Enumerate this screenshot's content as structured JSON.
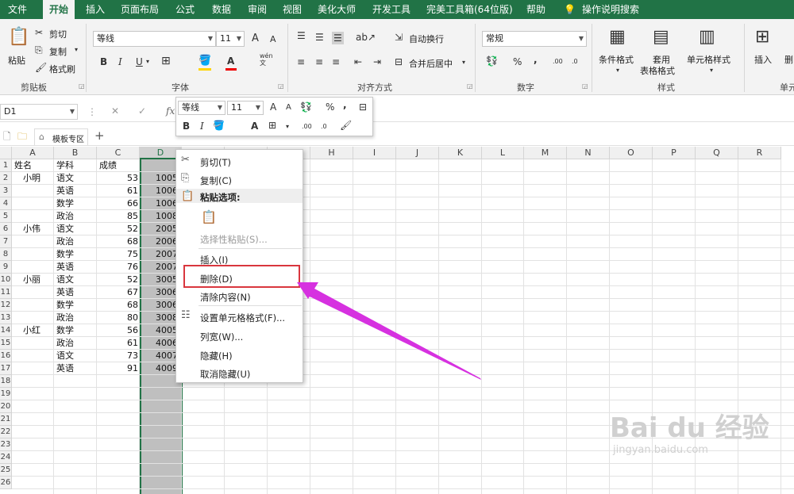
{
  "tabs": [
    "文件",
    "开始",
    "插入",
    "页面布局",
    "公式",
    "数据",
    "审阅",
    "视图",
    "美化大师",
    "开发工具",
    "完美工具箱(64位版)",
    "帮助",
    "操作说明搜索"
  ],
  "clipboard": {
    "paste": "粘贴",
    "cut": "剪切",
    "copy": "复制",
    "painter": "格式刷",
    "group": "剪贴板"
  },
  "font": {
    "name": "等线",
    "size": "11",
    "grow": "A",
    "shrink": "A",
    "bold": "B",
    "italic": "I",
    "underline": "U",
    "group": "字体",
    "wen": "wén",
    "wen2": "文"
  },
  "align": {
    "wrap": "自动换行",
    "merge": "合并后居中",
    "group": "对齐方式"
  },
  "number": {
    "format": "常规",
    "percent": "%",
    "comma": ",",
    "group": "数字",
    "dec_inc": ".00",
    "dec_dec": ".0"
  },
  "styles": {
    "cond": "条件格式",
    "table1": "套用",
    "table2": "表格格式",
    "cell": "单元格样式",
    "group": "样式"
  },
  "cells": {
    "insert": "插入",
    "delete": "删",
    "group": "单元"
  },
  "formula_bar": {
    "name_box": "D1",
    "fx": "fx"
  },
  "template_tab": "模板专区",
  "columns": [
    "A",
    "B",
    "C",
    "D",
    "E",
    "F",
    "G",
    "H",
    "I",
    "J",
    "K",
    "L",
    "M",
    "N",
    "O",
    "P",
    "Q",
    "R"
  ],
  "rows": [
    "1",
    "2",
    "3",
    "4",
    "5",
    "6",
    "7",
    "8",
    "9",
    "10",
    "11",
    "12",
    "13",
    "14",
    "15",
    "16",
    "17",
    "18",
    "19",
    "20",
    "21",
    "22",
    "23",
    "24",
    "25",
    "26"
  ],
  "data": [
    {
      "a": "姓名",
      "b": "学科",
      "c": "成绩",
      "d": ""
    },
    {
      "a": "小明",
      "b": "语文",
      "c": "53",
      "d": "1005"
    },
    {
      "a": "",
      "b": "英语",
      "c": "61",
      "d": "1006"
    },
    {
      "a": "",
      "b": "数学",
      "c": "66",
      "d": "1006"
    },
    {
      "a": "",
      "b": "政治",
      "c": "85",
      "d": "1008"
    },
    {
      "a": "小伟",
      "b": "语文",
      "c": "52",
      "d": "2005"
    },
    {
      "a": "",
      "b": "政治",
      "c": "68",
      "d": "2006"
    },
    {
      "a": "",
      "b": "数学",
      "c": "75",
      "d": "2007"
    },
    {
      "a": "",
      "b": "英语",
      "c": "76",
      "d": "2007"
    },
    {
      "a": "小丽",
      "b": "语文",
      "c": "52",
      "d": "3005"
    },
    {
      "a": "",
      "b": "英语",
      "c": "67",
      "d": "3006"
    },
    {
      "a": "",
      "b": "数学",
      "c": "68",
      "d": "3006"
    },
    {
      "a": "",
      "b": "政治",
      "c": "80",
      "d": "3008"
    },
    {
      "a": "小红",
      "b": "数学",
      "c": "56",
      "d": "4005"
    },
    {
      "a": "",
      "b": "政治",
      "c": "61",
      "d": "4006"
    },
    {
      "a": "",
      "b": "语文",
      "c": "73",
      "d": "4007"
    },
    {
      "a": "",
      "b": "英语",
      "c": "91",
      "d": "4009"
    }
  ],
  "mini_toolbar": {
    "font": "等线",
    "size": "11",
    "percent": "%",
    "comma": ","
  },
  "context_menu": {
    "cut": "剪切(T)",
    "copy": "复制(C)",
    "paste_options": "粘贴选项:",
    "paste_special": "选择性粘贴(S)...",
    "insert": "插入(I)",
    "delete": "删除(D)",
    "clear": "清除内容(N)",
    "format_cells": "设置单元格格式(F)...",
    "col_width": "列宽(W)...",
    "hide": "隐藏(H)",
    "unhide": "取消隐藏(U)"
  },
  "watermark": {
    "logo": "Bai du 经验",
    "url": "jingyan.baidu.com"
  },
  "colors": {
    "excel_green": "#217346",
    "highlight_red": "#d9363e",
    "arrow_magenta": "#d631e0"
  }
}
